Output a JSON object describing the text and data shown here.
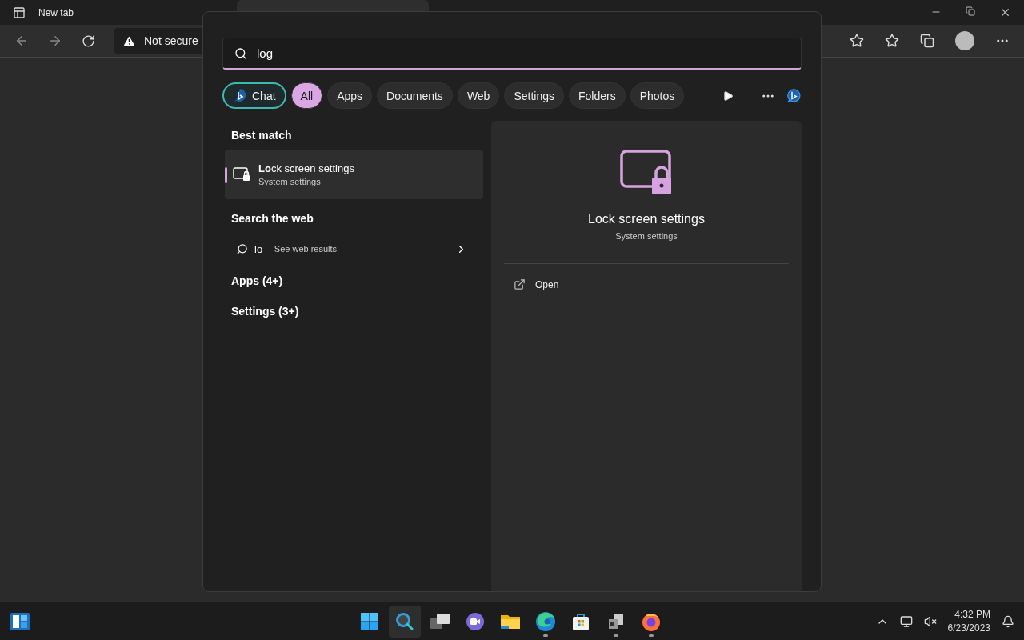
{
  "browser": {
    "tabs": [
      {
        "label": "New tab",
        "selected": false
      }
    ],
    "address": {
      "warning": "Not secure"
    }
  },
  "search": {
    "query": "log",
    "filters": [
      {
        "kind": "chat",
        "label": "Chat",
        "selected": false
      },
      {
        "kind": "chip",
        "label": "All",
        "selected": true
      },
      {
        "kind": "chip",
        "label": "Apps",
        "selected": false
      },
      {
        "kind": "chip",
        "label": "Documents",
        "selected": false
      },
      {
        "kind": "chip",
        "label": "Web",
        "selected": false
      },
      {
        "kind": "chip",
        "label": "Settings",
        "selected": false
      },
      {
        "kind": "chip",
        "label": "Folders",
        "selected": false
      },
      {
        "kind": "chip",
        "label": "Photos",
        "selected": false
      }
    ],
    "best_match": {
      "heading": "Best match",
      "title": "**Lo**ck screen settings",
      "subtitle": "System settings",
      "selected": true
    },
    "web": {
      "heading": "Search the web",
      "query": "lo",
      "suffix": "- See web results"
    },
    "sections": [
      "Apps (4+)",
      "Settings (3+)"
    ],
    "detail": {
      "title": "Lock screen settings",
      "subtitle": "System settings",
      "actions": [
        "Open"
      ]
    }
  },
  "taskbar": {
    "apps": [
      {
        "kind": "start",
        "running": false,
        "selected": false
      },
      {
        "kind": "search",
        "running": false,
        "selected": true
      },
      {
        "kind": "taskview",
        "running": false,
        "selected": false
      },
      {
        "kind": "chat",
        "running": false,
        "selected": false
      },
      {
        "kind": "folder",
        "running": false,
        "selected": false
      },
      {
        "kind": "edge",
        "running": true,
        "selected": false
      },
      {
        "kind": "store",
        "running": false,
        "selected": false
      },
      {
        "kind": "box",
        "running": true,
        "selected": false
      },
      {
        "kind": "firefox",
        "running": true,
        "selected": false
      }
    ],
    "time": "4:32 PM",
    "date": "6/23/2023"
  }
}
